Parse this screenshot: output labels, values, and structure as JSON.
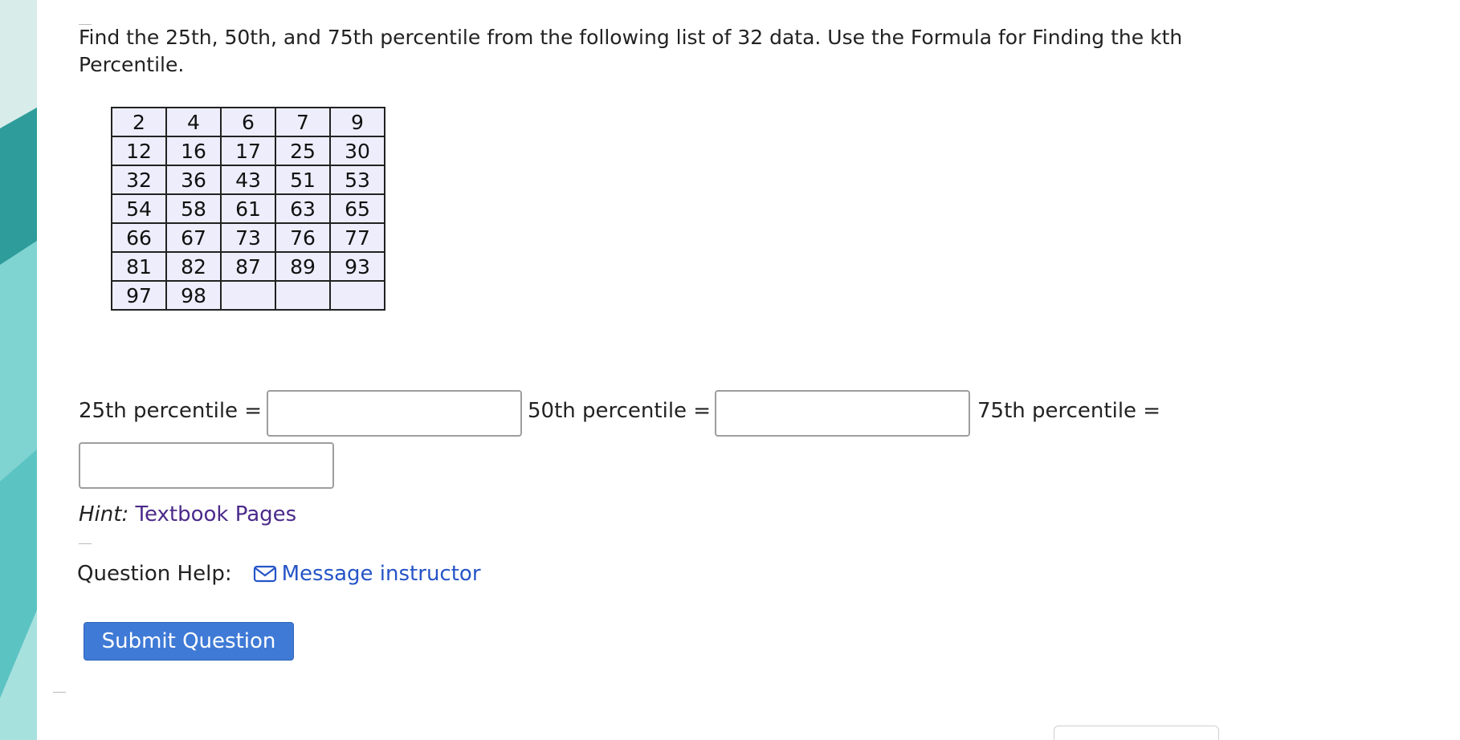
{
  "question": {
    "text": "Find the 25th, 50th, and 75th percentile from the following list of 32 data. Use the Formula for Finding the kth Percentile."
  },
  "data_table": {
    "rows": [
      [
        "2",
        "4",
        "6",
        "7",
        "9"
      ],
      [
        "12",
        "16",
        "17",
        "25",
        "30"
      ],
      [
        "32",
        "36",
        "43",
        "51",
        "53"
      ],
      [
        "54",
        "58",
        "61",
        "63",
        "65"
      ],
      [
        "66",
        "67",
        "73",
        "76",
        "77"
      ],
      [
        "81",
        "82",
        "87",
        "89",
        "93"
      ],
      [
        "97",
        "98",
        "",
        "",
        ""
      ]
    ]
  },
  "answers": {
    "p25_label": "25th percentile =",
    "p25_value": "",
    "p50_label": "50th percentile =",
    "p50_value": "",
    "p75_label": "75th percentile =",
    "p75_value": ""
  },
  "hint": {
    "label": "Hint:",
    "link": "Textbook Pages"
  },
  "help": {
    "label": "Question Help:",
    "icon": "envelope-icon",
    "link": "Message instructor"
  },
  "submit": {
    "label": "Submit Question"
  },
  "colors": {
    "table_bg": "#ededfc",
    "submit_bg": "#3f7ad6",
    "link_blue": "#2554c7",
    "link_purple": "#4b2a8a"
  }
}
